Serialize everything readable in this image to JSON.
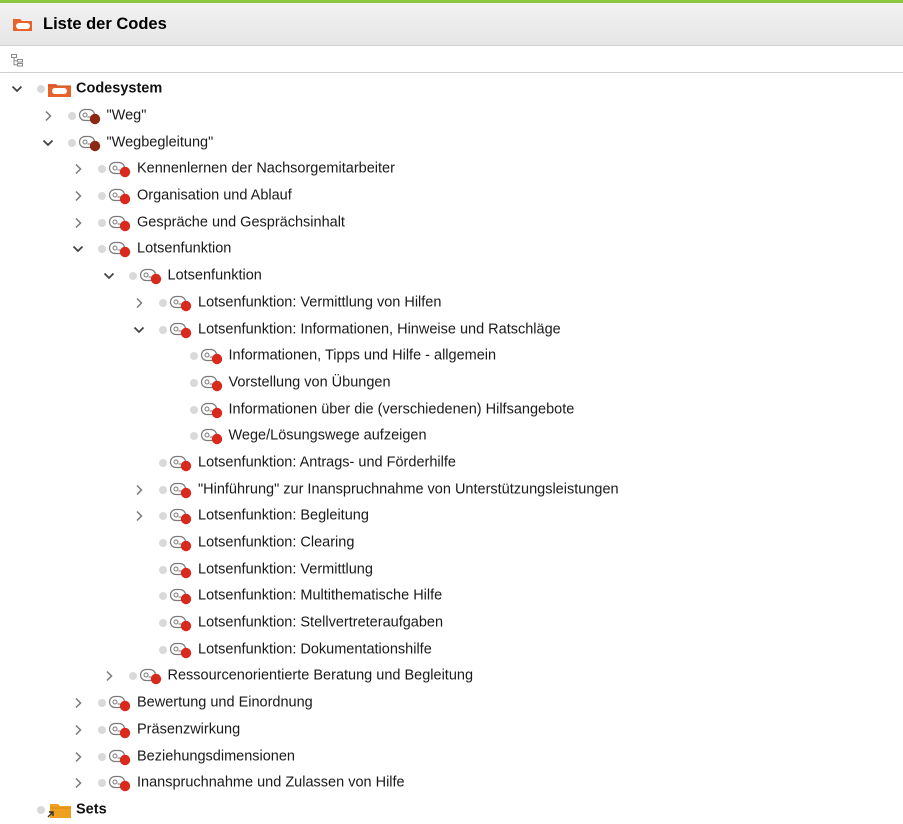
{
  "header": {
    "title": "Liste der Codes",
    "icon": "code-folder-icon"
  },
  "toolbar": {
    "icon": "tree-structure-icon"
  },
  "colors": {
    "accent_line": "#8dc63f",
    "code_dot": "#d9291c",
    "folder_orange": "#e8632b"
  },
  "tree": [
    {
      "level": 0,
      "label": "Codesystem",
      "expander": "expanded",
      "icon": "codesystem",
      "bold": true
    },
    {
      "level": 1,
      "label": "\"Weg\"",
      "expander": "collapsed",
      "icon": "code-dark"
    },
    {
      "level": 1,
      "label": "\"Wegbegleitung\"",
      "expander": "expanded",
      "icon": "code-dark"
    },
    {
      "level": 2,
      "label": "Kennenlernen der Nachsorgemitarbeiter",
      "expander": "collapsed",
      "icon": "code"
    },
    {
      "level": 2,
      "label": "Organisation und Ablauf",
      "expander": "collapsed",
      "icon": "code"
    },
    {
      "level": 2,
      "label": "Gespräche und Gesprächsinhalt",
      "expander": "collapsed",
      "icon": "code"
    },
    {
      "level": 2,
      "label": "Lotsenfunktion",
      "expander": "expanded",
      "icon": "code"
    },
    {
      "level": 3,
      "label": "Lotsenfunktion",
      "expander": "expanded",
      "icon": "code"
    },
    {
      "level": 4,
      "label": "Lotsenfunktion: Vermittlung von Hilfen",
      "expander": "collapsed",
      "icon": "code"
    },
    {
      "level": 4,
      "label": "Lotsenfunktion: Informationen, Hinweise und Ratschläge",
      "expander": "expanded",
      "icon": "code"
    },
    {
      "level": 5,
      "label": "Informationen, Tipps und Hilfe - allgemein",
      "expander": "none",
      "icon": "code"
    },
    {
      "level": 5,
      "label": "Vorstellung von Übungen",
      "expander": "none",
      "icon": "code"
    },
    {
      "level": 5,
      "label": "Informationen über die (verschiedenen) Hilfsangebote",
      "expander": "none",
      "icon": "code"
    },
    {
      "level": 5,
      "label": "Wege/Lösungswege aufzeigen",
      "expander": "none",
      "icon": "code"
    },
    {
      "level": 4,
      "label": "Lotsenfunktion: Antrags- und Förderhilfe",
      "expander": "none",
      "icon": "code"
    },
    {
      "level": 4,
      "label": "\"Hinführung\" zur Inanspruchnahme von Unterstützungsleistungen",
      "expander": "collapsed",
      "icon": "code"
    },
    {
      "level": 4,
      "label": "Lotsenfunktion: Begleitung",
      "expander": "collapsed",
      "icon": "code"
    },
    {
      "level": 4,
      "label": "Lotsenfunktion: Clearing",
      "expander": "none",
      "icon": "code"
    },
    {
      "level": 4,
      "label": "Lotsenfunktion: Vermittlung",
      "expander": "none",
      "icon": "code"
    },
    {
      "level": 4,
      "label": "Lotsenfunktion: Multithematische Hilfe",
      "expander": "none",
      "icon": "code"
    },
    {
      "level": 4,
      "label": "Lotsenfunktion: Stellvertreteraufgaben",
      "expander": "none",
      "icon": "code"
    },
    {
      "level": 4,
      "label": "Lotsenfunktion: Dokumentationshilfe",
      "expander": "none",
      "icon": "code"
    },
    {
      "level": 3,
      "label": "Ressourcenorientierte Beratung und Begleitung",
      "expander": "collapsed",
      "icon": "code"
    },
    {
      "level": 2,
      "label": "Bewertung und Einordnung",
      "expander": "collapsed",
      "icon": "code"
    },
    {
      "level": 2,
      "label": "Präsenzwirkung",
      "expander": "collapsed",
      "icon": "code"
    },
    {
      "level": 2,
      "label": "Beziehungsdimensionen",
      "expander": "collapsed",
      "icon": "code"
    },
    {
      "level": 2,
      "label": "Inanspruchnahme und Zulassen von Hilfe",
      "expander": "collapsed",
      "icon": "code"
    },
    {
      "level": 0,
      "label": "Sets",
      "expander": "none",
      "icon": "sets-folder",
      "bold": true
    }
  ]
}
